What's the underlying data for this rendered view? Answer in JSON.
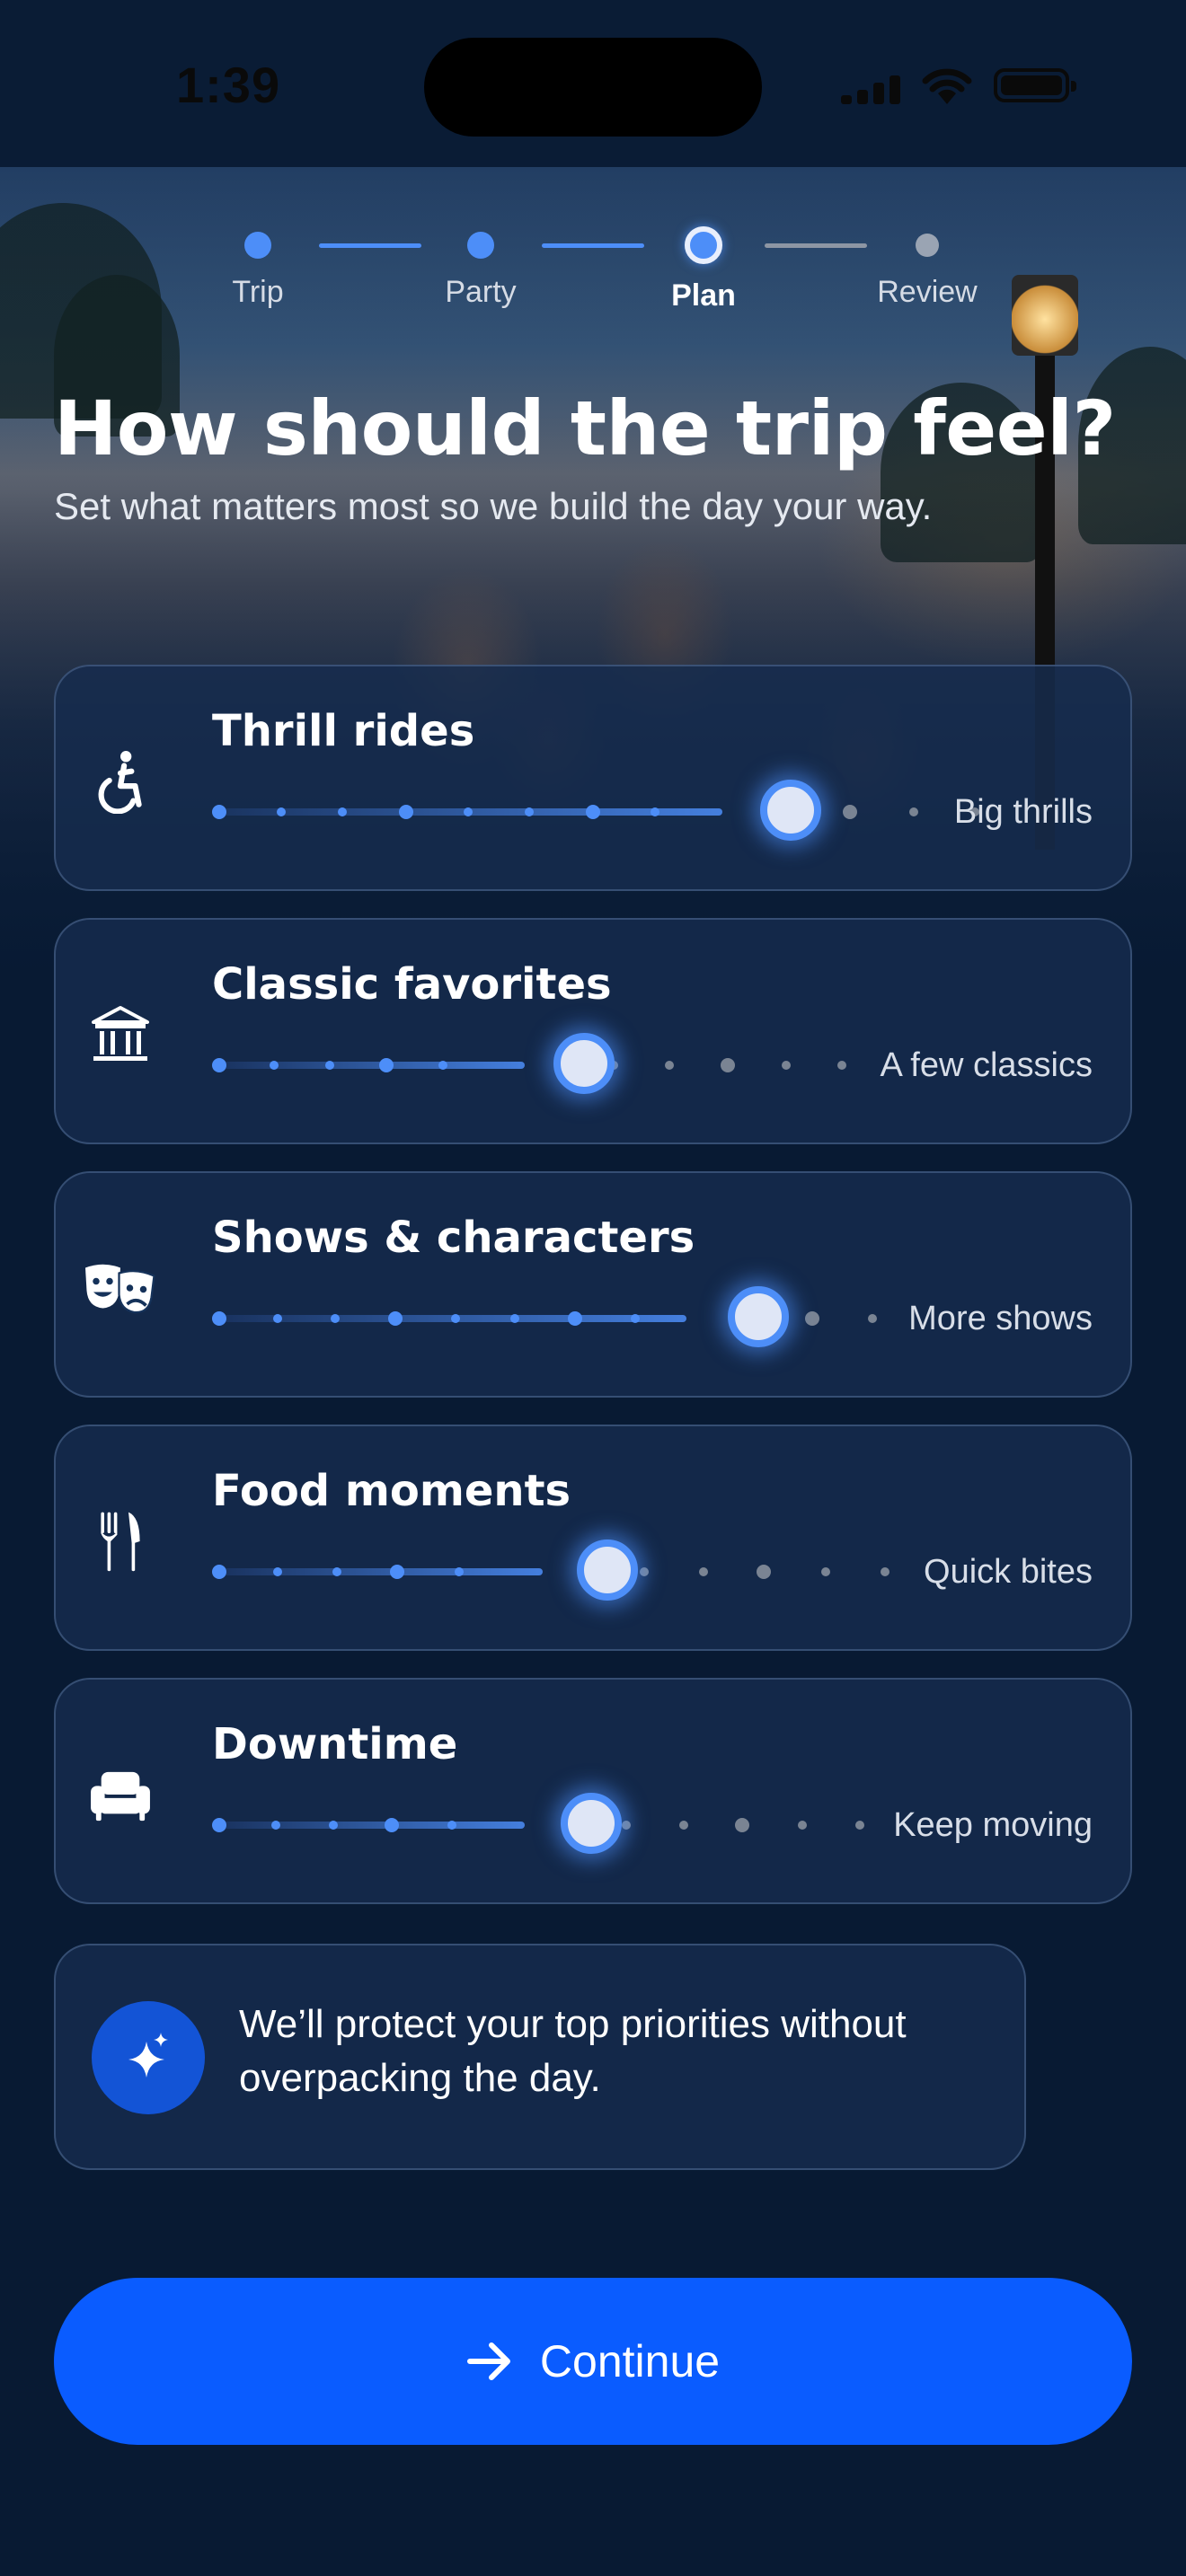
{
  "status_bar": {
    "time": "1:39"
  },
  "stepper": {
    "steps": [
      {
        "label": "Trip",
        "state": "done"
      },
      {
        "label": "Party",
        "state": "done"
      },
      {
        "label": "Plan",
        "state": "current"
      },
      {
        "label": "Review",
        "state": "upcoming"
      }
    ]
  },
  "header": {
    "title": "How should the trip feel?",
    "subtitle": "Set what matters most so we build the day your way."
  },
  "preferences": [
    {
      "title": "Thrill rides",
      "icon": "accessibility-icon",
      "value_label": "Big thrills",
      "level_fraction": 0.78
    },
    {
      "title": "Classic favorites",
      "icon": "museum-icon",
      "value_label": "A few classics",
      "level_fraction": 0.48
    },
    {
      "title": "Shows & characters",
      "icon": "theater-masks-icon",
      "value_label": "More shows",
      "level_fraction": 0.7
    },
    {
      "title": "Food moments",
      "icon": "utensils-icon",
      "value_label": "Quick bites",
      "level_fraction": 0.5
    },
    {
      "title": "Downtime",
      "icon": "armchair-icon",
      "value_label": "Keep moving",
      "level_fraction": 0.48
    }
  ],
  "info": {
    "icon": "sparkles-icon",
    "text": "We’ll protect your top priorities without overpacking the day."
  },
  "continue_button": {
    "label": "Continue",
    "icon": "arrow-right-icon"
  },
  "colors": {
    "accent": "#4d8ef8",
    "button": "#0a5cff",
    "background": "#081a33"
  }
}
